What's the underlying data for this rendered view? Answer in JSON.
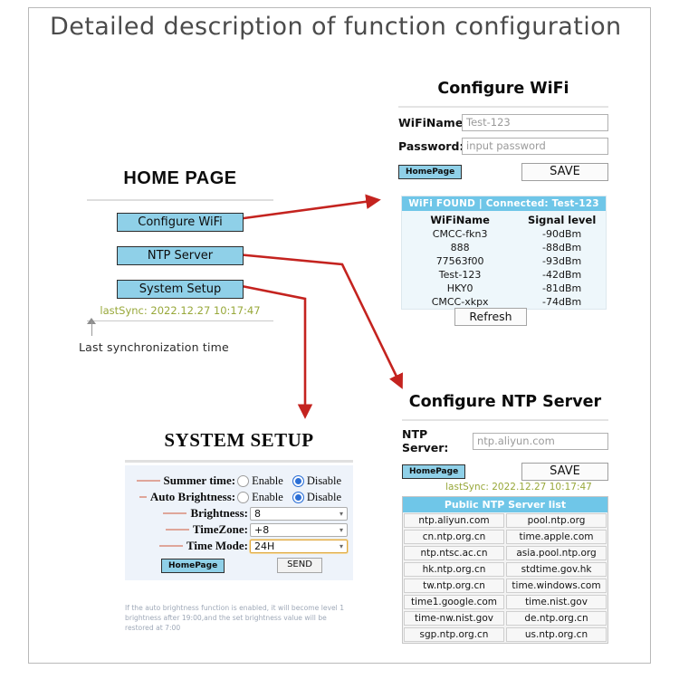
{
  "page": {
    "title": "Detailed description of function configuration"
  },
  "home": {
    "title": "HOME PAGE",
    "buttons": [
      {
        "label": "Configure WiFi"
      },
      {
        "label": "NTP Server"
      },
      {
        "label": "System Setup"
      }
    ],
    "last_sync": "lastSync: 2022.12.27 10:17:47",
    "callout": "Last synchronization time"
  },
  "wifi": {
    "title": "Configure WiFi",
    "fields": [
      {
        "label": "WiFiName:",
        "value": "Test-123",
        "placeholder": "Test-123"
      },
      {
        "label": "Password:",
        "value": "",
        "placeholder": "input password"
      }
    ],
    "homepage_label": "HomePage",
    "save_label": "SAVE",
    "list_header": "WiFi FOUND  |  Connected: Test-123",
    "col_name": "WiFiName",
    "col_signal": "Signal level",
    "networks": [
      {
        "name": "CMCC-fkn3",
        "signal": "-90dBm"
      },
      {
        "name": "888",
        "signal": "-88dBm"
      },
      {
        "name": "77563f00",
        "signal": "-93dBm"
      },
      {
        "name": "Test-123",
        "signal": "-42dBm"
      },
      {
        "name": "HKY0",
        "signal": "-81dBm"
      },
      {
        "name": "CMCC-xkpx",
        "signal": "-74dBm"
      }
    ],
    "refresh_label": "Refresh"
  },
  "ntp": {
    "title": "Configure NTP Server",
    "field_label": "NTP Server:",
    "field_value": "ntp.aliyun.com",
    "homepage_label": "HomePage",
    "save_label": "SAVE",
    "last_sync": "lastSync: 2022.12.27 10:17:47",
    "list_header": "Public NTP Server list",
    "servers": [
      [
        "ntp.aliyun.com",
        "pool.ntp.org"
      ],
      [
        "cn.ntp.org.cn",
        "time.apple.com"
      ],
      [
        "ntp.ntsc.ac.cn",
        "asia.pool.ntp.org"
      ],
      [
        "hk.ntp.org.cn",
        "stdtime.gov.hk"
      ],
      [
        "tw.ntp.org.cn",
        "time.windows.com"
      ],
      [
        "time1.google.com",
        "time.nist.gov"
      ],
      [
        "time-nw.nist.gov",
        "de.ntp.org.cn"
      ],
      [
        "sgp.ntp.org.cn",
        "us.ntp.org.cn"
      ]
    ]
  },
  "system_setup": {
    "title": "SYSTEM SETUP",
    "rows": [
      {
        "label": "Summer time:",
        "type": "radio",
        "options": [
          "Enable",
          "Disable"
        ],
        "selected": "Disable"
      },
      {
        "label": "Auto Brightness:",
        "type": "radio",
        "options": [
          "Enable",
          "Disable"
        ],
        "selected": "Disable"
      },
      {
        "label": "Brightness:",
        "type": "select",
        "value": "8"
      },
      {
        "label": "TimeZone:",
        "type": "select",
        "value": "+8"
      },
      {
        "label": "Time Mode:",
        "type": "select",
        "value": "24H",
        "focused": true
      }
    ],
    "homepage_label": "HomePage",
    "send_label": "SEND",
    "note": "If the auto brightness function is enabled, it will become level 1 brightness after 19:00,and the set brightness value will be restored at 7:00"
  },
  "colors": {
    "accent_blue": "#8fd0e8",
    "header_blue": "#6fc6e8",
    "arrow_red": "#c4231f",
    "sync_green": "#98a83a",
    "radio_blue": "#2c6fd6",
    "focus_orange": "#e0a93f"
  }
}
